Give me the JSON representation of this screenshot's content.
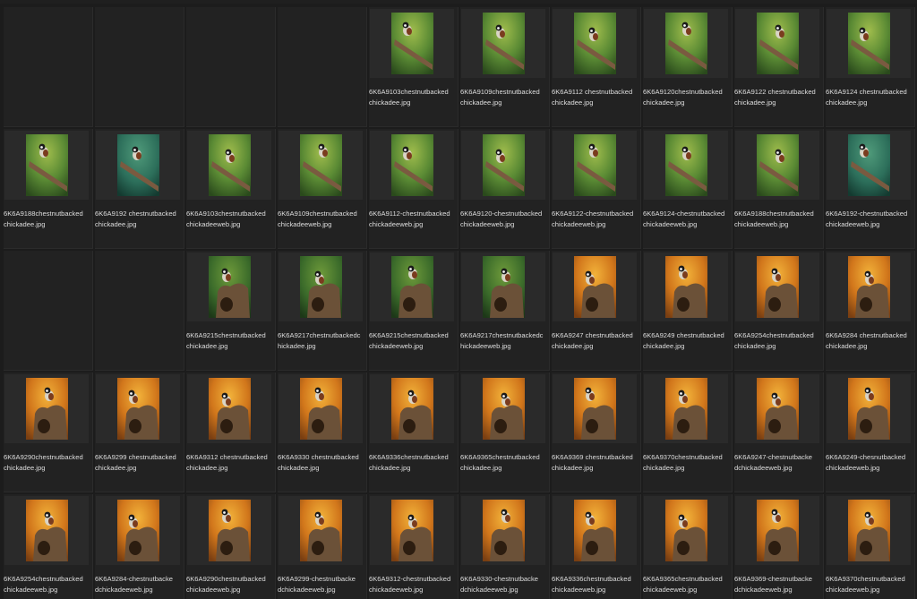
{
  "colors": {
    "background": "#1c1c1c",
    "cell": "#222222",
    "thumb_bg": "#2a2a2a",
    "text": "#dedede"
  },
  "rows": [
    {
      "row": 0,
      "items": [
        null,
        null,
        null,
        null,
        {
          "line1": "6K6A9103chestnutbacked",
          "line2": "chickadee.jpg",
          "scene": "green-branch"
        },
        {
          "line1": "6K6A9109chestnutbacked",
          "line2": "chickadee.jpg",
          "scene": "green-branch"
        },
        {
          "line1": "6K6A9112 chestnutbacked",
          "line2": "chickadee.jpg",
          "scene": "green-branch"
        },
        {
          "line1": "6K6A9120chestnutbacked",
          "line2": "chickadee.jpg",
          "scene": "green-branch"
        },
        {
          "line1": "6K6A9122 chestnutbacked",
          "line2": "chickadee.jpg",
          "scene": "green-branch"
        },
        {
          "line1": "6K6A9124 chestnutbacked",
          "line2": "chickadee.jpg",
          "scene": "green-branch"
        }
      ]
    },
    {
      "row": 1,
      "items": [
        {
          "line1": "6K6A9188chestnutbacked",
          "line2": "chickadee.jpg",
          "scene": "green-branch"
        },
        {
          "line1": "6K6A9192 chestnutbacked",
          "line2": "chickadee.jpg",
          "scene": "teal-branch"
        },
        {
          "line1": "6K6A9103chestnutbacked",
          "line2": "chickadeeweb.jpg",
          "scene": "green-branch"
        },
        {
          "line1": "6K6A9109chestnutbacked",
          "line2": "chickadeeweb.jpg",
          "scene": "green-branch"
        },
        {
          "line1": "6K6A9112-chestnutbacked",
          "line2": "chickadeeweb.jpg",
          "scene": "green-branch"
        },
        {
          "line1": "6K6A9120-chestnutbacked",
          "line2": "chickadeeweb.jpg",
          "scene": "green-branch"
        },
        {
          "line1": "6K6A9122-chestnutbacked",
          "line2": "chickadeeweb.jpg",
          "scene": "green-branch"
        },
        {
          "line1": "6K6A9124-chestnutbacked",
          "line2": "chickadeeweb.jpg",
          "scene": "green-branch"
        },
        {
          "line1": "6K6A9188chestnutbacked",
          "line2": "chickadeeweb.jpg",
          "scene": "green-branch"
        },
        {
          "line1": "6K6A9192-chestnutbacked",
          "line2": "chickadeeweb.jpg",
          "scene": "teal-branch"
        }
      ]
    },
    {
      "row": 2,
      "items": [
        null,
        null,
        {
          "line1": "6K6A9215chestnutbacked",
          "line2": "chickadee.jpg",
          "scene": "green-stump"
        },
        {
          "line1": "6K6A9217chestnutbackedc",
          "line2": "hickadee.jpg",
          "scene": "green-stump"
        },
        {
          "line1": "6K6A9215chestnutbacked",
          "line2": "chickadeeweb.jpg",
          "scene": "green-stump"
        },
        {
          "line1": "6K6A9217chestnutbackedc",
          "line2": "hickadeeweb.jpg",
          "scene": "green-stump"
        },
        {
          "line1": "6K6A9247 chestnutbacked",
          "line2": "chickadee.jpg",
          "scene": "orange-stump"
        },
        {
          "line1": "6K6A9249 chestnutbacked",
          "line2": "chickadee.jpg",
          "scene": "orange-stump"
        },
        {
          "line1": "6K6A9254chestnutbacked",
          "line2": "chickadee.jpg",
          "scene": "orange-stump"
        },
        {
          "line1": "6K6A9284 chestnutbacked",
          "line2": "chickadee.jpg",
          "scene": "orange-stump"
        }
      ]
    },
    {
      "row": 3,
      "items": [
        {
          "line1": "6K6A9290chestnutbacked",
          "line2": "chickadee.jpg",
          "scene": "orange-stump"
        },
        {
          "line1": "6K6A9299 chestnutbacked",
          "line2": "chickadee.jpg",
          "scene": "orange-stump"
        },
        {
          "line1": "6K6A9312 chestnutbacked",
          "line2": "chickadee.jpg",
          "scene": "orange-stump"
        },
        {
          "line1": "6K6A9330 chestnutbacked",
          "line2": "chickadee.jpg",
          "scene": "orange-stump"
        },
        {
          "line1": "6K6A9336chestnutbacked",
          "line2": "chickadee.jpg",
          "scene": "orange-stump"
        },
        {
          "line1": "6K6A9365chestnutbacked",
          "line2": "chickadee.jpg",
          "scene": "orange-stump"
        },
        {
          "line1": "6K6A9369 chestnutbacked",
          "line2": "chickadee.jpg",
          "scene": "orange-stump"
        },
        {
          "line1": "6K6A9370chestnutbacked",
          "line2": "chickadee.jpg",
          "scene": "orange-stump"
        },
        {
          "line1": "6K6A9247-chestnutbacke",
          "line2": "dchickadeeweb.jpg",
          "scene": "orange-stump"
        },
        {
          "line1": "6K6A9249-chesnutbacked",
          "line2": "chickadeeweb.jpg",
          "scene": "orange-stump"
        }
      ]
    },
    {
      "row": 4,
      "items": [
        {
          "line1": "6K6A9254chestnutbacked",
          "line2": "chickadeeweb.jpg",
          "scene": "orange-stump"
        },
        {
          "line1": "6K6A9284-chestnutbacke",
          "line2": "dchickadeeweb.jpg",
          "scene": "orange-stump"
        },
        {
          "line1": "6K6A9290chestnutbacked",
          "line2": "chickadeeweb.jpg",
          "scene": "orange-stump"
        },
        {
          "line1": "6K6A9299-chestnutbacke",
          "line2": "dchickadeeweb.jpg",
          "scene": "orange-stump"
        },
        {
          "line1": "6K6A9312-chestnutbacked",
          "line2": "chickadeeweb.jpg",
          "scene": "orange-stump"
        },
        {
          "line1": "6K6A9330-chestnutbacke",
          "line2": "dchickadeeweb.jpg",
          "scene": "orange-stump"
        },
        {
          "line1": "6K6A9336chestnutbacked",
          "line2": "chickadeeweb.jpg",
          "scene": "orange-stump"
        },
        {
          "line1": "6K6A9365chestnutbacked",
          "line2": "chickadeeweb.jpg",
          "scene": "orange-stump"
        },
        {
          "line1": "6K6A9369-chestnutbacke",
          "line2": "dchickadeeweb.jpg",
          "scene": "orange-stump"
        },
        {
          "line1": "6K6A9370chestnutbacked",
          "line2": "chickadeeweb.jpg",
          "scene": "orange-stump"
        }
      ]
    }
  ]
}
